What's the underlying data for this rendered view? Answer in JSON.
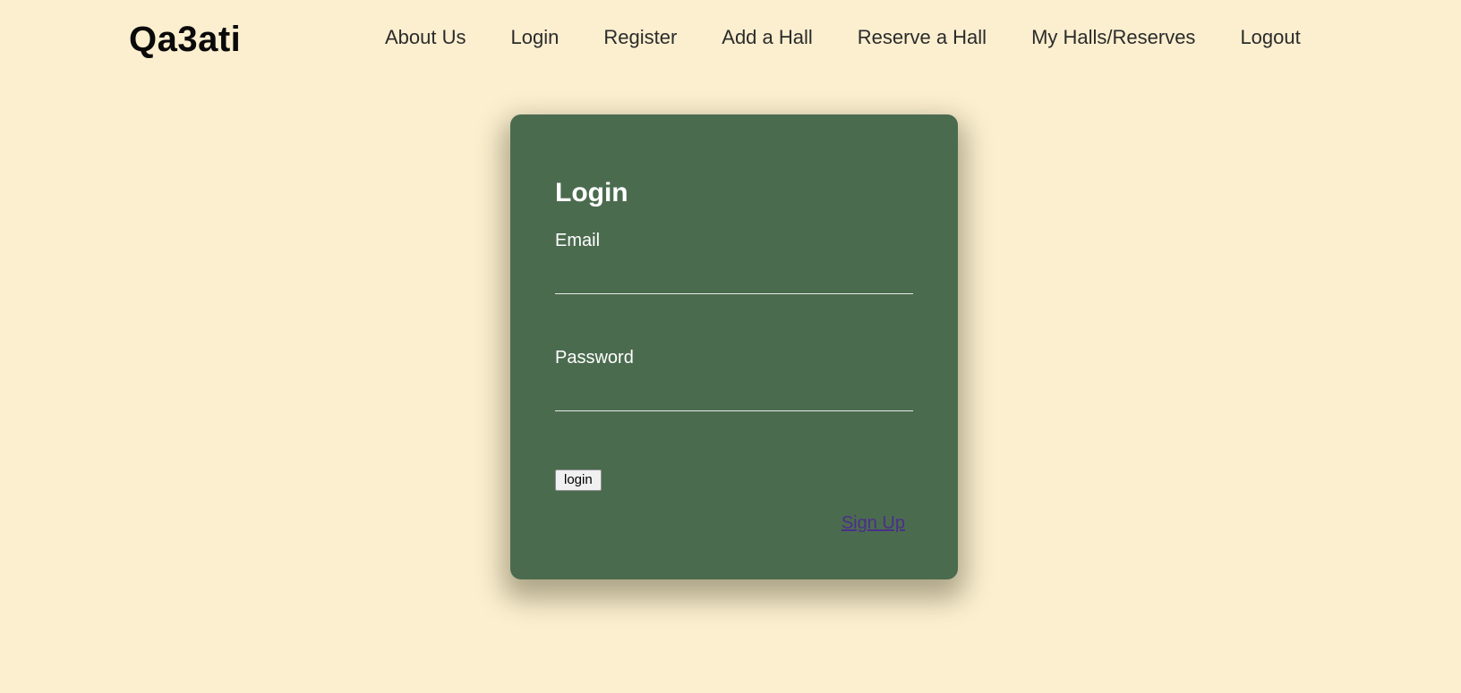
{
  "header": {
    "brand": "Qa3ati",
    "nav": [
      {
        "label": "About Us"
      },
      {
        "label": "Login"
      },
      {
        "label": "Register"
      },
      {
        "label": "Add a Hall"
      },
      {
        "label": "Reserve a Hall"
      },
      {
        "label": "My Halls/Reserves"
      },
      {
        "label": "Logout"
      }
    ]
  },
  "login_form": {
    "title": "Login",
    "email_label": "Email",
    "email_value": "",
    "password_label": "Password",
    "password_value": "",
    "submit_label": "login",
    "signup_link": "Sign Up"
  },
  "colors": {
    "background": "#fbefcf",
    "card": "#4b6b4f",
    "link": "#4a2f8a"
  }
}
